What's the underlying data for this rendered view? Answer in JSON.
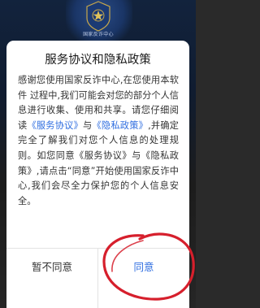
{
  "background": {
    "badge_text": "国家反诈中心"
  },
  "dialog": {
    "title": "服务协议和隐私政策",
    "body": {
      "intro": "感谢您使用国家反诈中心,在您使用本软件 过程中,我们可能会对您的部分个人信息进行收集、使用和共享。请您仔细阅读",
      "link_service": "《服务协议》",
      "and": "与",
      "link_privacy": "《隐私政策》",
      "middle": ",并确定完全了解我们对您个人信息的处理规则。如您同意《服务协议》与《隐私政策》,请点击“同意”开始使用国家反诈中心,我们会尽全力保护您的个人信息安全。"
    },
    "buttons": {
      "disagree_label": "暂不同意",
      "agree_label": "同意"
    }
  },
  "colors": {
    "link": "#2f6ee0",
    "annotation": "#d61f2c",
    "dialog_bg": "#ffffff"
  }
}
